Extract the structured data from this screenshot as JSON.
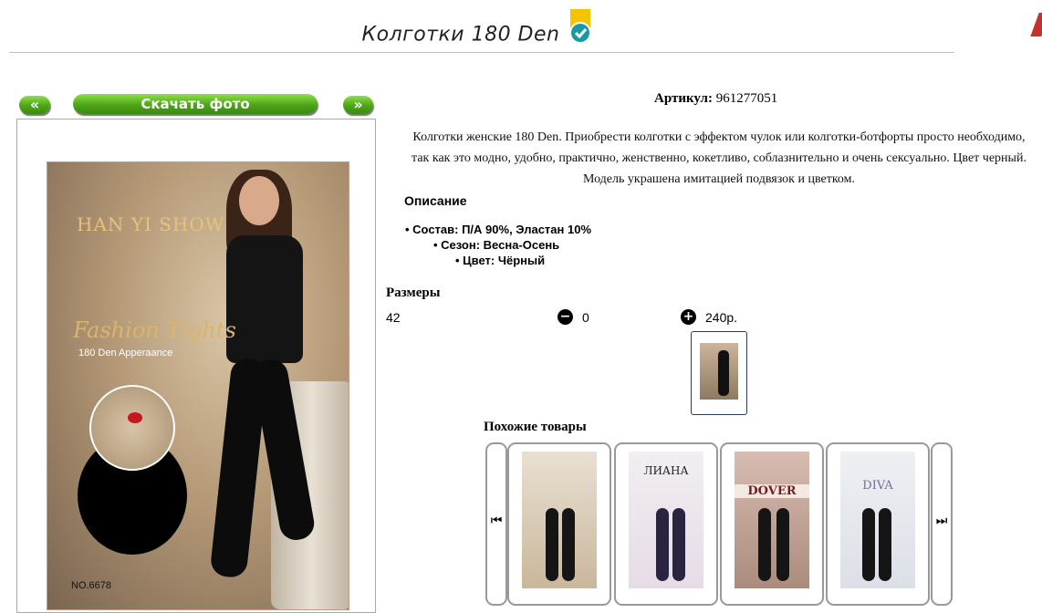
{
  "header": {
    "title": "Колготки 180 Den",
    "verified_icon": "verified-check-icon",
    "accent": "#f5c400"
  },
  "gallery": {
    "prev_label": "«",
    "download_label": "Скачать фото",
    "next_label": "»",
    "button_color": "#4da417",
    "photo": {
      "brand": "HAN YI SHOW",
      "script_text": "Fashion Tights",
      "appearance": "180 Den Apperaance",
      "model_no": "NO.6678"
    }
  },
  "product": {
    "article_label": "Артикул:",
    "article_value": "961277051",
    "description": "Колготки женские 180 Den. Приобрести колготки с эффектом чулок или колготки-ботфорты просто необходимо, так как это модно, удобно, практично, женственно, кокетливо, соблазнительно и очень сексуально. Цвет черный. Модель украшена имитацией подвязок и цветком.",
    "details_heading": "Описание",
    "details": [
      "Состав: П/А 90%, Эластан 10%",
      "Сезон: Весна-Осень",
      "Цвет: Чёрный"
    ]
  },
  "sizes": {
    "heading": "Размеры",
    "rows": [
      {
        "size": "42",
        "quantity": "0",
        "price": "240р."
      }
    ]
  },
  "similar": {
    "heading": "Похожие товары",
    "prev_icon": "skip-back-icon",
    "next_icon": "skip-forward-icon",
    "items": [
      {
        "logo": ""
      },
      {
        "logo": "ЛИАНА"
      },
      {
        "logo": "DOVER"
      },
      {
        "logo": "DIVA"
      }
    ]
  }
}
